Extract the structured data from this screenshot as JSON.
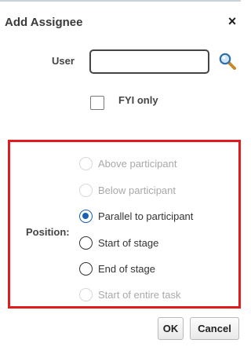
{
  "dialog": {
    "title": "Add Assignee",
    "close_label": "×"
  },
  "user": {
    "label": "User",
    "value": "",
    "placeholder": "",
    "search_icon": "magnifier-icon"
  },
  "fyi": {
    "label": "FYI only",
    "checked": false
  },
  "position": {
    "label": "Position:",
    "options": [
      {
        "label": "Above participant",
        "enabled": false,
        "checked": false
      },
      {
        "label": "Below participant",
        "enabled": false,
        "checked": false
      },
      {
        "label": "Parallel to participant",
        "enabled": true,
        "checked": true
      },
      {
        "label": "Start of stage",
        "enabled": true,
        "checked": false
      },
      {
        "label": "End of stage",
        "enabled": true,
        "checked": false
      },
      {
        "label": "Start of entire task",
        "enabled": false,
        "checked": false
      }
    ]
  },
  "buttons": {
    "ok": "OK",
    "cancel": "Cancel"
  },
  "colors": {
    "highlight_border": "#e01b1b",
    "radio_selected": "#1a5fb4"
  }
}
